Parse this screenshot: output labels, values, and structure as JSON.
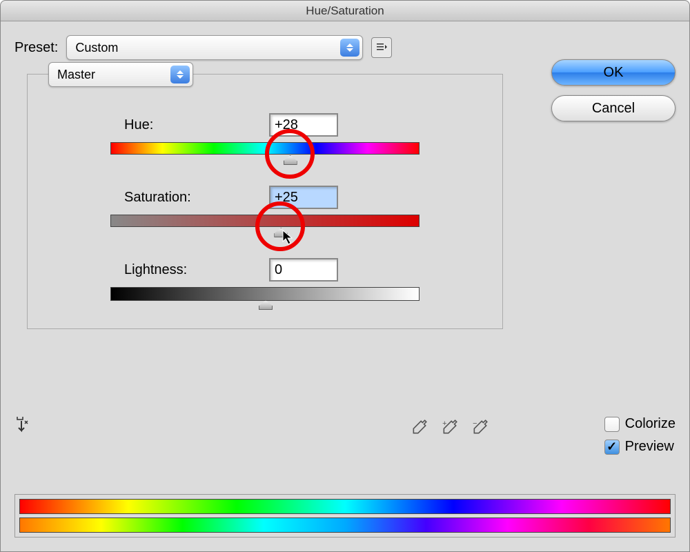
{
  "title": "Hue/Saturation",
  "preset": {
    "label": "Preset:",
    "value": "Custom"
  },
  "buttons": {
    "ok": "OK",
    "cancel": "Cancel"
  },
  "channel": {
    "value": "Master"
  },
  "sliders": {
    "hue": {
      "label": "Hue:",
      "value": "+28",
      "position": 58
    },
    "saturation": {
      "label": "Saturation:",
      "value": "+25",
      "position": 55
    },
    "lightness": {
      "label": "Lightness:",
      "value": "0",
      "position": 50
    }
  },
  "checkboxes": {
    "colorize": {
      "label": "Colorize",
      "checked": false
    },
    "preview": {
      "label": "Preview",
      "checked": true
    }
  }
}
